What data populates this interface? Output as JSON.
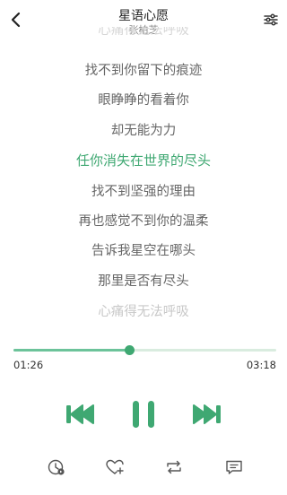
{
  "header": {
    "title": "星语心愿",
    "artist": "张柏芝"
  },
  "lyrics": {
    "lines": [
      {
        "text": "心痛得无法呼吸",
        "state": "fade-top"
      },
      {
        "text": "找不到你留下的痕迹",
        "state": "normal"
      },
      {
        "text": "眼睁睁的看着你",
        "state": "normal"
      },
      {
        "text": "却无能为力",
        "state": "normal"
      },
      {
        "text": "任你消失在世界的尽头",
        "state": "current"
      },
      {
        "text": "找不到坚强的理由",
        "state": "normal"
      },
      {
        "text": "再也感觉不到你的温柔",
        "state": "normal"
      },
      {
        "text": "告诉我星空在哪头",
        "state": "normal"
      },
      {
        "text": "那里是否有尽头",
        "state": "normal"
      },
      {
        "text": "心痛得无法呼吸",
        "state": "faded"
      }
    ]
  },
  "player": {
    "elapsed": "01:26",
    "total": "03:18",
    "progress_fraction": 0.44
  },
  "colors": {
    "accent": "#3fa872",
    "accent_light": "#6cc39a",
    "track": "#d9ecdf"
  },
  "icons": {
    "back": "chevron-left-icon",
    "settings": "sliders-icon",
    "prev": "skip-previous-icon",
    "pause": "pause-icon",
    "next": "skip-next-icon",
    "sleep_timer": "clock-icon",
    "favorite": "heart-plus-icon",
    "repeat": "repeat-icon",
    "comments": "comment-icon"
  }
}
